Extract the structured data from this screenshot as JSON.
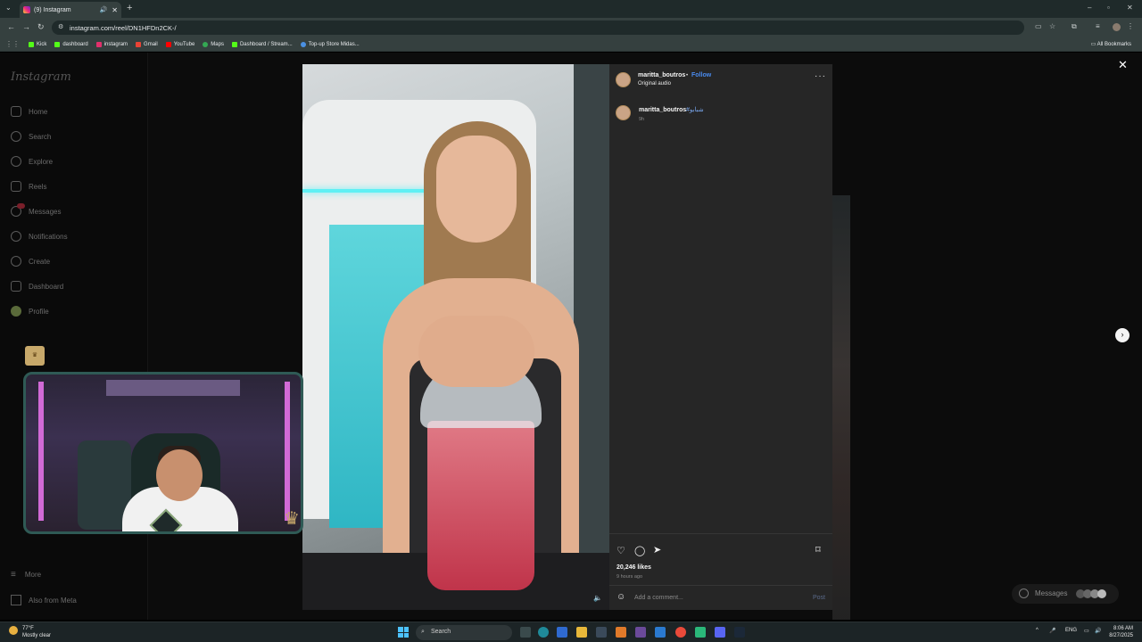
{
  "browser": {
    "tab_title": "(9) Instagram",
    "url": "instagram.com/reel/DN1HFDn2CK-/",
    "bookmarks": [
      "Kick",
      "dashboard",
      "instagram",
      "Gmail",
      "YouTube",
      "Maps",
      "Dashboard / Stream...",
      "Top-up Store Midas..."
    ],
    "all_bookmarks": "All Bookmarks"
  },
  "sidebar": {
    "logo": "Instagram",
    "items": [
      "Home",
      "Search",
      "Explore",
      "Reels",
      "Messages",
      "Notifications",
      "Create",
      "Dashboard",
      "Profile"
    ],
    "more": "More",
    "also_from_meta": "Also from Meta"
  },
  "post": {
    "username": "maritta_boutros",
    "separator": "•",
    "follow": "Follow",
    "audio": "Original audio",
    "caption_user": "maritta_boutros",
    "caption_tag": "#شبابو",
    "caption_time": "9h",
    "likes": "20,246 likes",
    "posted": "9 hours ago",
    "comment_placeholder": "Add a comment...",
    "post_button": "Post"
  },
  "overlay": {
    "messages": "Messages"
  },
  "taskbar": {
    "temp": "77°F",
    "weather": "Mostly clear",
    "search": "Search",
    "lang": "ENG",
    "time": "8:06 AM",
    "date": "8/27/2025"
  },
  "colors": {
    "follow": "#4a8cf0",
    "panel_bg": "#262626",
    "page_bg": "#0c0c0c"
  }
}
